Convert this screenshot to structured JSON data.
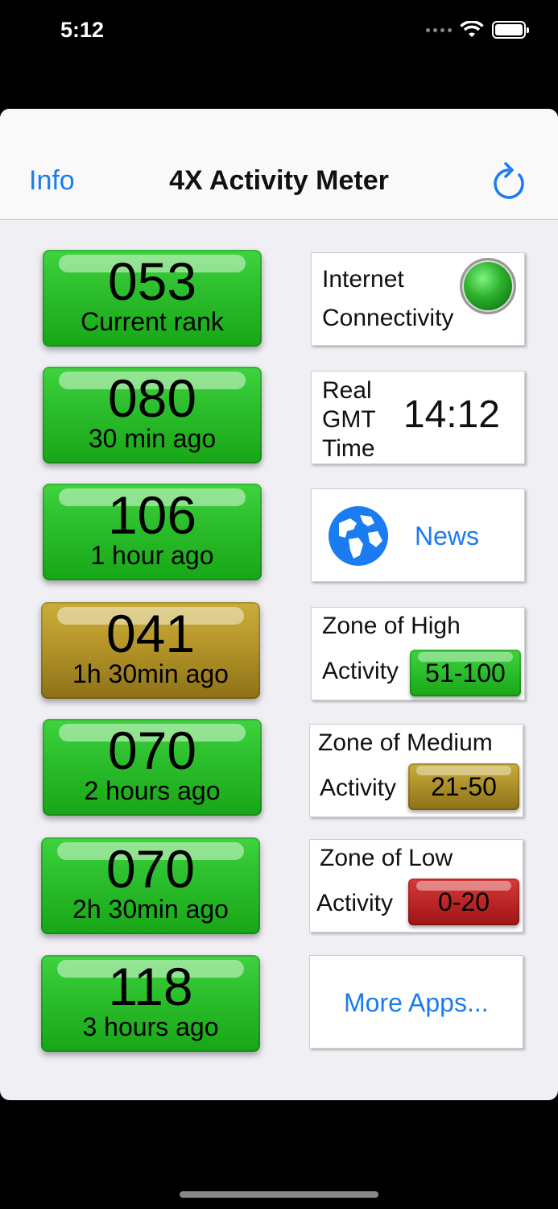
{
  "status_bar": {
    "time": "5:12"
  },
  "nav": {
    "info_label": "Info",
    "title": "4X Activity Meter",
    "refresh_icon": "refresh-icon"
  },
  "tiles": [
    {
      "value": "053",
      "label": "Current rank",
      "color": "#2fc12f"
    },
    {
      "value": "080",
      "label": "30 min ago",
      "color": "#2fc12f"
    },
    {
      "value": "106",
      "label": "1 hour ago",
      "color": "#2fc12f"
    },
    {
      "value": "041",
      "label": "1h 30min ago",
      "color": "#b8982a"
    },
    {
      "value": "070",
      "label": "2 hours ago",
      "color": "#2fc12f"
    },
    {
      "value": "070",
      "label": "2h 30min ago",
      "color": "#2fc12f"
    },
    {
      "value": "118",
      "label": "3 hours ago",
      "color": "#2fc12f"
    }
  ],
  "cards": {
    "internet": {
      "line1": "Internet",
      "line2": "Connectivity",
      "status_color": "#2fb32f"
    },
    "gmt": {
      "line1": "Real",
      "line2": "GMT",
      "line3": "Time",
      "time": "14:12"
    },
    "news": {
      "label": "News",
      "icon": "globe-icon"
    },
    "high": {
      "line1": "Zone of High",
      "line2": "Activity",
      "range": "51-100",
      "color": "#2fc12f"
    },
    "medium": {
      "line1": "Zone of Medium",
      "line2": "Activity",
      "range": "21-50",
      "color": "#b8982a"
    },
    "low": {
      "line1": "Zone of Low",
      "line2": "Activity",
      "range": "0-20",
      "color": "#c02020"
    },
    "more": {
      "label": "More Apps..."
    }
  }
}
